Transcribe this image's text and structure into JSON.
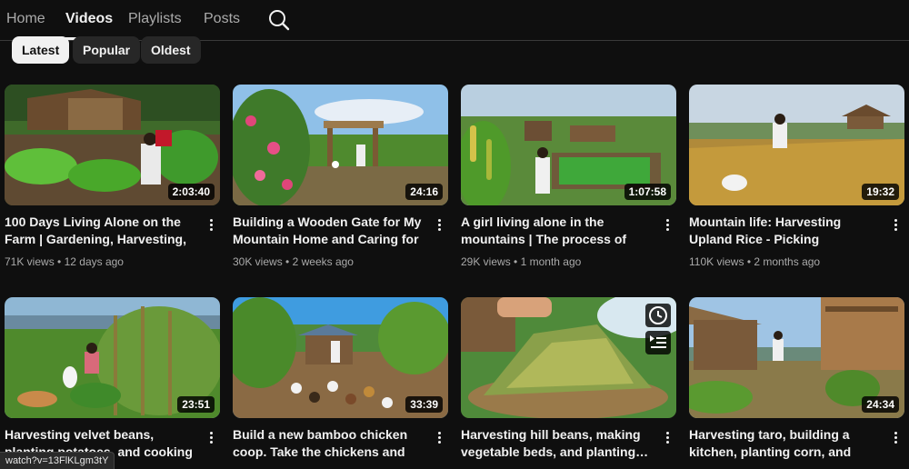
{
  "nav": {
    "tabs": [
      {
        "label": "Home"
      },
      {
        "label": "Videos"
      },
      {
        "label": "Playlists"
      },
      {
        "label": "Posts"
      }
    ],
    "active_tab": "Videos",
    "search_icon": "search-icon"
  },
  "chips": [
    {
      "label": "Latest"
    },
    {
      "label": "Popular"
    },
    {
      "label": "Oldest"
    }
  ],
  "videos": [
    {
      "title": "100 Days Living Alone on the Farm | Gardening, Harvesting, Cooking &…",
      "views": "71K views",
      "age": "12 days ago",
      "duration": "2:03:40"
    },
    {
      "title": "Building a Wooden Gate for My Mountain Home and Caring for the…",
      "views": "30K views",
      "age": "2 weeks ago",
      "duration": "24:16"
    },
    {
      "title": "A girl living alone in the mountains | The process of growing and…",
      "views": "29K views",
      "age": "1 month ago",
      "duration": "1:07:58"
    },
    {
      "title": "Mountain life: Harvesting Upland Rice - Picking Vegetables for…",
      "views": "110K views",
      "age": "2 months ago",
      "duration": "19:32"
    },
    {
      "title": "Harvesting velvet beans, planting potatoes, and cooking a meal from…",
      "duration": "23:51"
    },
    {
      "title": "Build a new bamboo chicken coop. Take the chickens and ducks to liv…",
      "duration": "33:39"
    },
    {
      "title": "Harvesting hill beans, making vegetable beds, and planting…",
      "duration": ""
    },
    {
      "title": "Harvesting taro, building a kitchen, planting corn, and cooking dinner",
      "duration": "24:34"
    }
  ],
  "meta_separator": "•",
  "hover_icons": [
    "clock-icon",
    "add-to-queue-icon"
  ],
  "status_bar": {
    "url": "watch?v=13FlKLgm3tY"
  }
}
